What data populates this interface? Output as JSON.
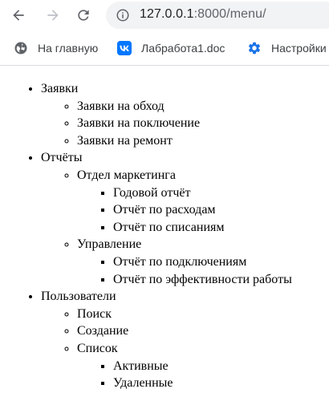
{
  "browser": {
    "url_host": "127.0.0.1",
    "url_rest": ":8000/menu/"
  },
  "bookmarks": [
    {
      "label": "На главную",
      "icon": "globe-icon"
    },
    {
      "label": "Лабработа1.doc",
      "icon": "vk-icon"
    },
    {
      "label": "Настройки",
      "icon": "gear-icon"
    }
  ],
  "colors": {
    "vk_brand": "#0077ff",
    "settings_blue": "#1a73e8",
    "toolbar_icon": "#5f6368",
    "omnibox_bg": "#f1f3f4"
  },
  "menu": [
    {
      "label": "Заявки",
      "children": [
        {
          "label": "Заявки на обход"
        },
        {
          "label": "Заявки на поключение"
        },
        {
          "label": "Заявки на ремонт"
        }
      ]
    },
    {
      "label": "Отчёты",
      "children": [
        {
          "label": "Отдел маркетинга",
          "children": [
            {
              "label": "Годовой отчёт"
            },
            {
              "label": "Отчёт по расходам"
            },
            {
              "label": "Отчёт по списаниям"
            }
          ]
        },
        {
          "label": "Управление",
          "children": [
            {
              "label": "Отчёт по подключениям"
            },
            {
              "label": "Отчёт по эффективности работы"
            }
          ]
        }
      ]
    },
    {
      "label": "Пользователи",
      "children": [
        {
          "label": "Поиск"
        },
        {
          "label": "Создание"
        },
        {
          "label": "Список",
          "children": [
            {
              "label": "Активные"
            },
            {
              "label": "Удаленные"
            }
          ]
        }
      ]
    }
  ]
}
